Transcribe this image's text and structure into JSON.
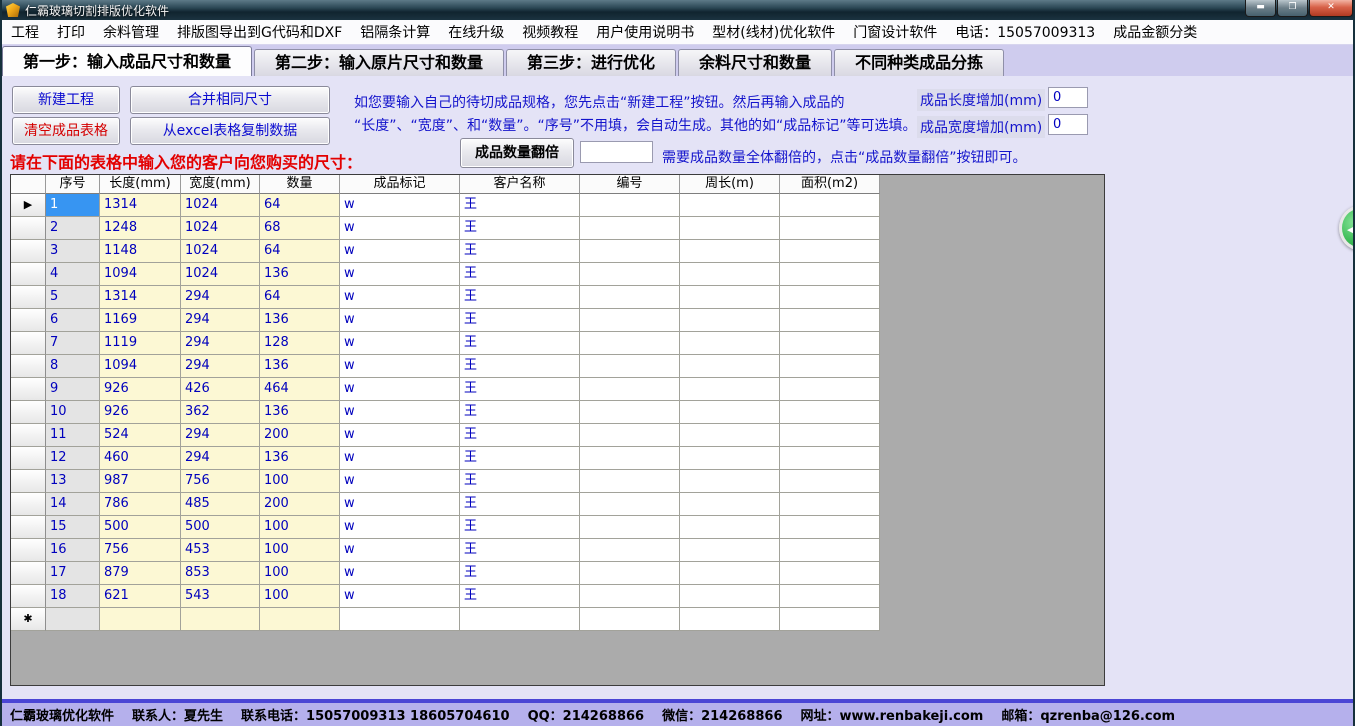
{
  "window": {
    "title": "仁霸玻璃切割排版优化软件"
  },
  "menu_bar": {
    "items": [
      "工程",
      "打印",
      "余料管理",
      "排版图导出到G代码和DXF",
      "铝隔条计算",
      "在线升级",
      "视频教程",
      "用户使用说明书",
      "型材(线材)优化软件",
      "门窗设计软件",
      "电话：15057009313",
      "成品金额分类"
    ]
  },
  "tab_bar": {
    "tabs": [
      {
        "label": "第一步：输入成品尺寸和数量",
        "active": true
      },
      {
        "label": "第二步：输入原片尺寸和数量",
        "active": false
      },
      {
        "label": "第三步：进行优化",
        "active": false
      },
      {
        "label": "余料尺寸和数量",
        "active": false
      },
      {
        "label": "不同种类成品分拣",
        "active": false
      }
    ]
  },
  "toolbar": {
    "new_project": "新建工程",
    "merge_same_size": "合并相同尺寸",
    "clear_table": "清空成品表格",
    "copy_from_excel": "从excel表格复制数据",
    "double_quantity": "成品数量翻倍",
    "double_quantity_value": "",
    "instruction_line1": "如您要输入自己的待切成品规格，您先点击“新建工程”按钮。然后再输入成品的",
    "instruction_line2": "“长度”、“宽度”、和“数量”。“序号”不用填，会自动生成。其他的如“成品标记”等可选填。",
    "double_hint": "需要成品数量全体翻倍的，点击“成品数量翻倍”按钮即可。",
    "input_prompt": "请在下面的表格中输入您的客户向您购买的尺寸：",
    "length_add_label": "成品长度增加(mm)",
    "length_add_value": "0",
    "width_add_label": "成品宽度增加(mm)",
    "width_add_value": "0"
  },
  "table": {
    "headers": [
      "序号",
      "长度(mm)",
      "宽度(mm)",
      "数量",
      "成品标记",
      "客户名称",
      "编号",
      "周长(m)",
      "面积(m2)"
    ],
    "current_row_marker": "▶",
    "new_row_marker": "✱",
    "selected_row_index": 0,
    "rows": [
      {
        "seq": "1",
        "length": "1314",
        "width": "1024",
        "qty": "64",
        "mark": "w",
        "customer": "王",
        "code": "",
        "perimeter": "",
        "area": ""
      },
      {
        "seq": "2",
        "length": "1248",
        "width": "1024",
        "qty": "68",
        "mark": "w",
        "customer": "王",
        "code": "",
        "perimeter": "",
        "area": ""
      },
      {
        "seq": "3",
        "length": "1148",
        "width": "1024",
        "qty": "64",
        "mark": "w",
        "customer": "王",
        "code": "",
        "perimeter": "",
        "area": ""
      },
      {
        "seq": "4",
        "length": "1094",
        "width": "1024",
        "qty": "136",
        "mark": "w",
        "customer": "王",
        "code": "",
        "perimeter": "",
        "area": ""
      },
      {
        "seq": "5",
        "length": "1314",
        "width": "294",
        "qty": "64",
        "mark": "w",
        "customer": "王",
        "code": "",
        "perimeter": "",
        "area": ""
      },
      {
        "seq": "6",
        "length": "1169",
        "width": "294",
        "qty": "136",
        "mark": "w",
        "customer": "王",
        "code": "",
        "perimeter": "",
        "area": ""
      },
      {
        "seq": "7",
        "length": "1119",
        "width": "294",
        "qty": "128",
        "mark": "w",
        "customer": "王",
        "code": "",
        "perimeter": "",
        "area": ""
      },
      {
        "seq": "8",
        "length": "1094",
        "width": "294",
        "qty": "136",
        "mark": "w",
        "customer": "王",
        "code": "",
        "perimeter": "",
        "area": ""
      },
      {
        "seq": "9",
        "length": "926",
        "width": "426",
        "qty": "464",
        "mark": "w",
        "customer": "王",
        "code": "",
        "perimeter": "",
        "area": ""
      },
      {
        "seq": "10",
        "length": "926",
        "width": "362",
        "qty": "136",
        "mark": "w",
        "customer": "王",
        "code": "",
        "perimeter": "",
        "area": ""
      },
      {
        "seq": "11",
        "length": "524",
        "width": "294",
        "qty": "200",
        "mark": "w",
        "customer": "王",
        "code": "",
        "perimeter": "",
        "area": ""
      },
      {
        "seq": "12",
        "length": "460",
        "width": "294",
        "qty": "136",
        "mark": "w",
        "customer": "王",
        "code": "",
        "perimeter": "",
        "area": ""
      },
      {
        "seq": "13",
        "length": "987",
        "width": "756",
        "qty": "100",
        "mark": "w",
        "customer": "王",
        "code": "",
        "perimeter": "",
        "area": ""
      },
      {
        "seq": "14",
        "length": "786",
        "width": "485",
        "qty": "200",
        "mark": "w",
        "customer": "王",
        "code": "",
        "perimeter": "",
        "area": ""
      },
      {
        "seq": "15",
        "length": "500",
        "width": "500",
        "qty": "100",
        "mark": "w",
        "customer": "王",
        "code": "",
        "perimeter": "",
        "area": ""
      },
      {
        "seq": "16",
        "length": "756",
        "width": "453",
        "qty": "100",
        "mark": "w",
        "customer": "王",
        "code": "",
        "perimeter": "",
        "area": ""
      },
      {
        "seq": "17",
        "length": "879",
        "width": "853",
        "qty": "100",
        "mark": "w",
        "customer": "王",
        "code": "",
        "perimeter": "",
        "area": ""
      },
      {
        "seq": "18",
        "length": "621",
        "width": "543",
        "qty": "100",
        "mark": "w",
        "customer": "王",
        "code": "",
        "perimeter": "",
        "area": ""
      }
    ]
  },
  "status_bar": {
    "parts": [
      "仁霸玻璃优化软件",
      "联系人：夏先生",
      "联系电话：15057009313 18605704610",
      "QQ：214268866",
      "微信：214268866",
      "网址：www.renbakeji.com",
      "邮箱：qzrenba@126.com"
    ]
  },
  "colors": {
    "cell_text_blue": "#0000bd",
    "selected_cell_bg": "#3795f2",
    "yellow_cell_bg": "#fcf8d4",
    "status_bar_bg": "#b5b0ec",
    "red_text": "#e30000",
    "green_float": "#3fbd58"
  }
}
